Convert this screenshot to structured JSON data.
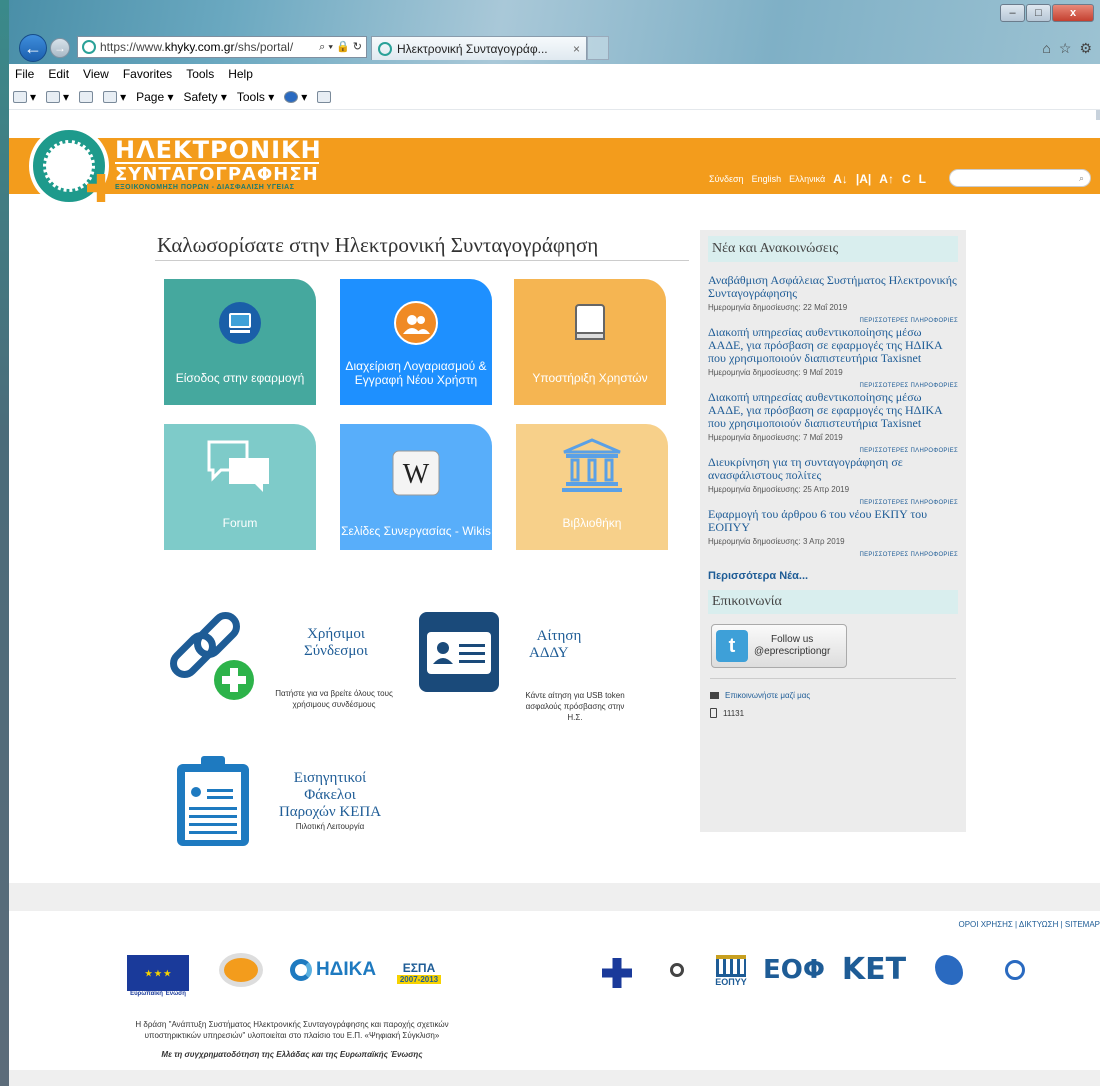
{
  "browser": {
    "url_prefix": "https://www.",
    "url_domain": "khyky.com.gr",
    "url_path": "/shs/portal/",
    "address_tools": "⌕ ▾ 🔒 ↻",
    "tab_title": "Ηλεκτρονική Συνταγογράφ...",
    "tab_close": "×",
    "menu": [
      "File",
      "Edit",
      "View",
      "Favorites",
      "Tools",
      "Help"
    ],
    "commands": [
      "Page ▾",
      "Safety ▾",
      "Tools ▾"
    ],
    "window_buttons": [
      "–",
      "□",
      "x"
    ],
    "right_icons": [
      "⌂",
      "☆",
      "⚙"
    ]
  },
  "header": {
    "logo_line1": "ΗΛΕΚΤΡΟΝΙΚΗ",
    "logo_line2": "ΣΥΝΤΑΓΟΓΡΑΦΗΣΗ",
    "logo_tagline": "ΕΞΟΙΚΟΝΟΜΗΣΗ ΠΟΡΩΝ - ΔΙΑΣΦΑΛΙΣΗ ΥΓΕΙΑΣ",
    "login": "Σύνδεση",
    "english": "English",
    "greek": "Ελληνικά",
    "size_small": "A↓",
    "size_normal": "|A|",
    "size_large": "A↑",
    "contrast": "C",
    "layout": "L",
    "search_icon": "⌕"
  },
  "welcome": "Καλωσορίσατε στην Ηλεκτρονική Συνταγογράφηση",
  "tiles": [
    {
      "label": "Είσοδος στην εφαρμογή",
      "color": "#45a89e"
    },
    {
      "label": "Διαχείριση Λογαριασμού & Εγγραφή Νέου Χρήστη",
      "color": "#1e90ff"
    },
    {
      "label": "Υποστήριξη Χρηστών",
      "color": "#f5b552"
    },
    {
      "label": "Forum",
      "color": "#7ecbc9"
    },
    {
      "label": "Σελίδες Συνεργασίας - Wikis",
      "color": "#58aefa"
    },
    {
      "label": "Βιβλιοθήκη",
      "color": "#f7d08a"
    }
  ],
  "links": {
    "useful_title_1": "Χρήσιμοι",
    "useful_title_2": "Σύνδεσμοι",
    "useful_desc": "Πατήστε για να βρείτε όλους τους χρήσιμους συνδέσμους",
    "adday_title_1": "Αίτηση",
    "adday_title_2": "ΑΔΔΥ",
    "adday_desc": "Κάντε αίτηση για USB token ασφαλούς πρόσβασης στην Η.Σ.",
    "kepa_title_1": "Εισηγητικοί",
    "kepa_title_2": "Φάκελοι",
    "kepa_title_3": "Παροχών ΚΕΠΑ",
    "kepa_desc": "Πιλοτική Λειτουργία"
  },
  "news": {
    "heading": "Νέα και Ανακοινώσεις",
    "more_label": "ΠΕΡΙΣΣΟΤΕΡΕΣ ΠΛΗΡΟΦΟΡΙΕΣ",
    "items": [
      {
        "title": "Αναβάθμιση Ασφάλειας Συστήματος Ηλεκτρονικής Συνταγογράφησης",
        "date": "Ημερομηνία δημοσίευσης: 22 Μαΐ 2019"
      },
      {
        "title": "Διακοπή υπηρεσίας αυθεντικοποίησης μέσω ΑΑΔΕ, για πρόσβαση σε εφαρμογές της ΗΔΙΚΑ που χρησιμοποιούν διαπιστευτήρια Taxisnet",
        "date": "Ημερομηνία δημοσίευσης: 9 Μαΐ 2019"
      },
      {
        "title": "Διακοπή υπηρεσίας αυθεντικοποίησης μέσω ΑΑΔΕ, για πρόσβαση σε εφαρμογές της ΗΔΙΚΑ που χρησιμοποιούν διαπιστευτήρια Taxisnet",
        "date": "Ημερομηνία δημοσίευσης: 7 Μαΐ 2019"
      },
      {
        "title": "Διευκρίνηση για τη συνταγογράφηση σε ανασφάλιστους πολίτες",
        "date": "Ημερομηνία δημοσίευσης: 25 Απρ 2019"
      },
      {
        "title": "Εφαρμογή του άρθρου 6 του νέου ΕΚΠΥ του ΕΟΠΥΥ",
        "date": "Ημερομηνία δημοσίευσης: 3 Απρ 2019"
      }
    ],
    "more_news": "Περισσότερα Νέα..."
  },
  "contact": {
    "heading": "Επικοινωνία",
    "follow": "Follow us",
    "handle": "@eprescriptiongr",
    "contact_us": "Επικοινωνήστε μαζί μας",
    "phone": "11131"
  },
  "footer": {
    "links": "ΟΡΟΙ ΧΡΗΣΗΣ | ΔΙΚΤΥΩΣΗ | SITEMAP",
    "eu_label": "Ευρωπαϊκή Ένωση",
    "idika": "ΗΔΙΚΑ",
    "espa": "ΕΣΠΑ",
    "espa_years": "2007-2013",
    "eopyy": "ΕΟΠΥΥ",
    "eof": "ΕΟΦ",
    "kset": "ΚΕΤ",
    "text": "Η δράση \"Ανάπτυξη Συστήματος Ηλεκτρονικής Συνταγογράφησης και παροχής σχετικών υποστηρικτικών υπηρεσιών\" υλοποιείται στο πλαίσιο του Ε.Π. «Ψηφιακή Σύγκλιση»",
    "funding": "Με τη συγχρηματοδότηση της Ελλάδας και της Ευρωπαϊκής Ένωσης"
  }
}
